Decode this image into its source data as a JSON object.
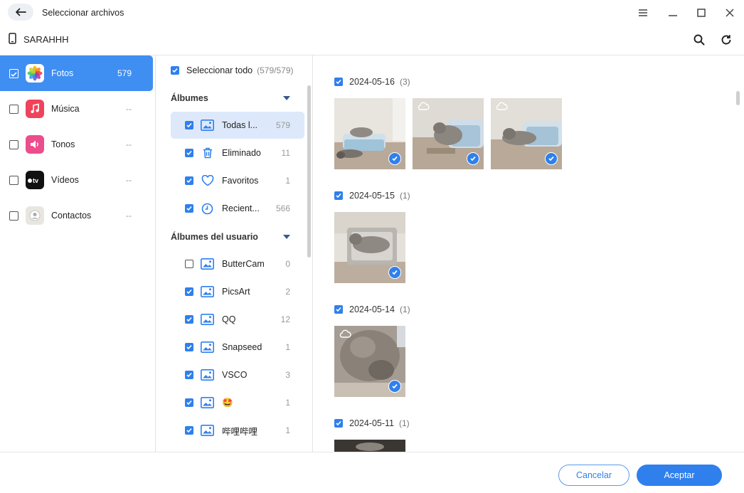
{
  "window": {
    "title": "Seleccionar archivos"
  },
  "device": {
    "name": "SARAHHH"
  },
  "categories": [
    {
      "label": "Fotos",
      "count": "579",
      "checked": true,
      "icon": "photos-icon"
    },
    {
      "label": "Música",
      "count": "--",
      "checked": false,
      "icon": "music-icon"
    },
    {
      "label": "Tonos",
      "count": "--",
      "checked": false,
      "icon": "ringtones-icon"
    },
    {
      "label": "Vídeos",
      "count": "--",
      "checked": false,
      "icon": "apple-tv-icon"
    },
    {
      "label": "Contactos",
      "count": "--",
      "checked": false,
      "icon": "contacts-icon"
    }
  ],
  "albums_panel": {
    "select_all_label": "Seleccionar todo",
    "select_all_count": "(579/579)",
    "albums_heading": "Álbumes",
    "user_albums_heading": "Álbumes del usuario",
    "albums": [
      {
        "name": "Todas l...",
        "count": "579",
        "checked": true,
        "icon": "image-icon"
      },
      {
        "name": "Eliminado",
        "count": "11",
        "checked": true,
        "icon": "trash-icon"
      },
      {
        "name": "Favoritos",
        "count": "1",
        "checked": true,
        "icon": "heart-icon"
      },
      {
        "name": "Recient...",
        "count": "566",
        "checked": true,
        "icon": "clock-icon"
      }
    ],
    "user_albums": [
      {
        "name": "ButterCam",
        "count": "0",
        "checked": false,
        "icon": "image-icon"
      },
      {
        "name": "PicsArt",
        "count": "2",
        "checked": true,
        "icon": "image-icon"
      },
      {
        "name": "QQ",
        "count": "12",
        "checked": true,
        "icon": "image-icon"
      },
      {
        "name": "Snapseed",
        "count": "1",
        "checked": true,
        "icon": "image-icon"
      },
      {
        "name": "VSCO",
        "count": "3",
        "checked": true,
        "icon": "image-icon"
      },
      {
        "name": "🤩",
        "count": "1",
        "checked": true,
        "icon": "image-icon"
      },
      {
        "name": "哔哩哔哩",
        "count": "1",
        "checked": true,
        "icon": "image-icon"
      }
    ]
  },
  "photo_groups": [
    {
      "date": "2024-05-16",
      "count": "(3)",
      "photos": [
        {
          "cloud": false,
          "checked": true
        },
        {
          "cloud": true,
          "checked": true
        },
        {
          "cloud": true,
          "checked": true
        }
      ]
    },
    {
      "date": "2024-05-15",
      "count": "(1)",
      "photos": [
        {
          "cloud": false,
          "checked": true
        }
      ]
    },
    {
      "date": "2024-05-14",
      "count": "(1)",
      "photos": [
        {
          "cloud": true,
          "checked": true
        }
      ]
    },
    {
      "date": "2024-05-11",
      "count": "(1)",
      "photos": [
        {
          "cloud": false,
          "checked": true
        }
      ]
    }
  ],
  "footer": {
    "cancel_label": "Cancelar",
    "accept_label": "Aceptar"
  },
  "colors": {
    "accent": "#2f80ed",
    "active_row": "#3f8ef2",
    "album_active_bg": "#dde9fb"
  }
}
